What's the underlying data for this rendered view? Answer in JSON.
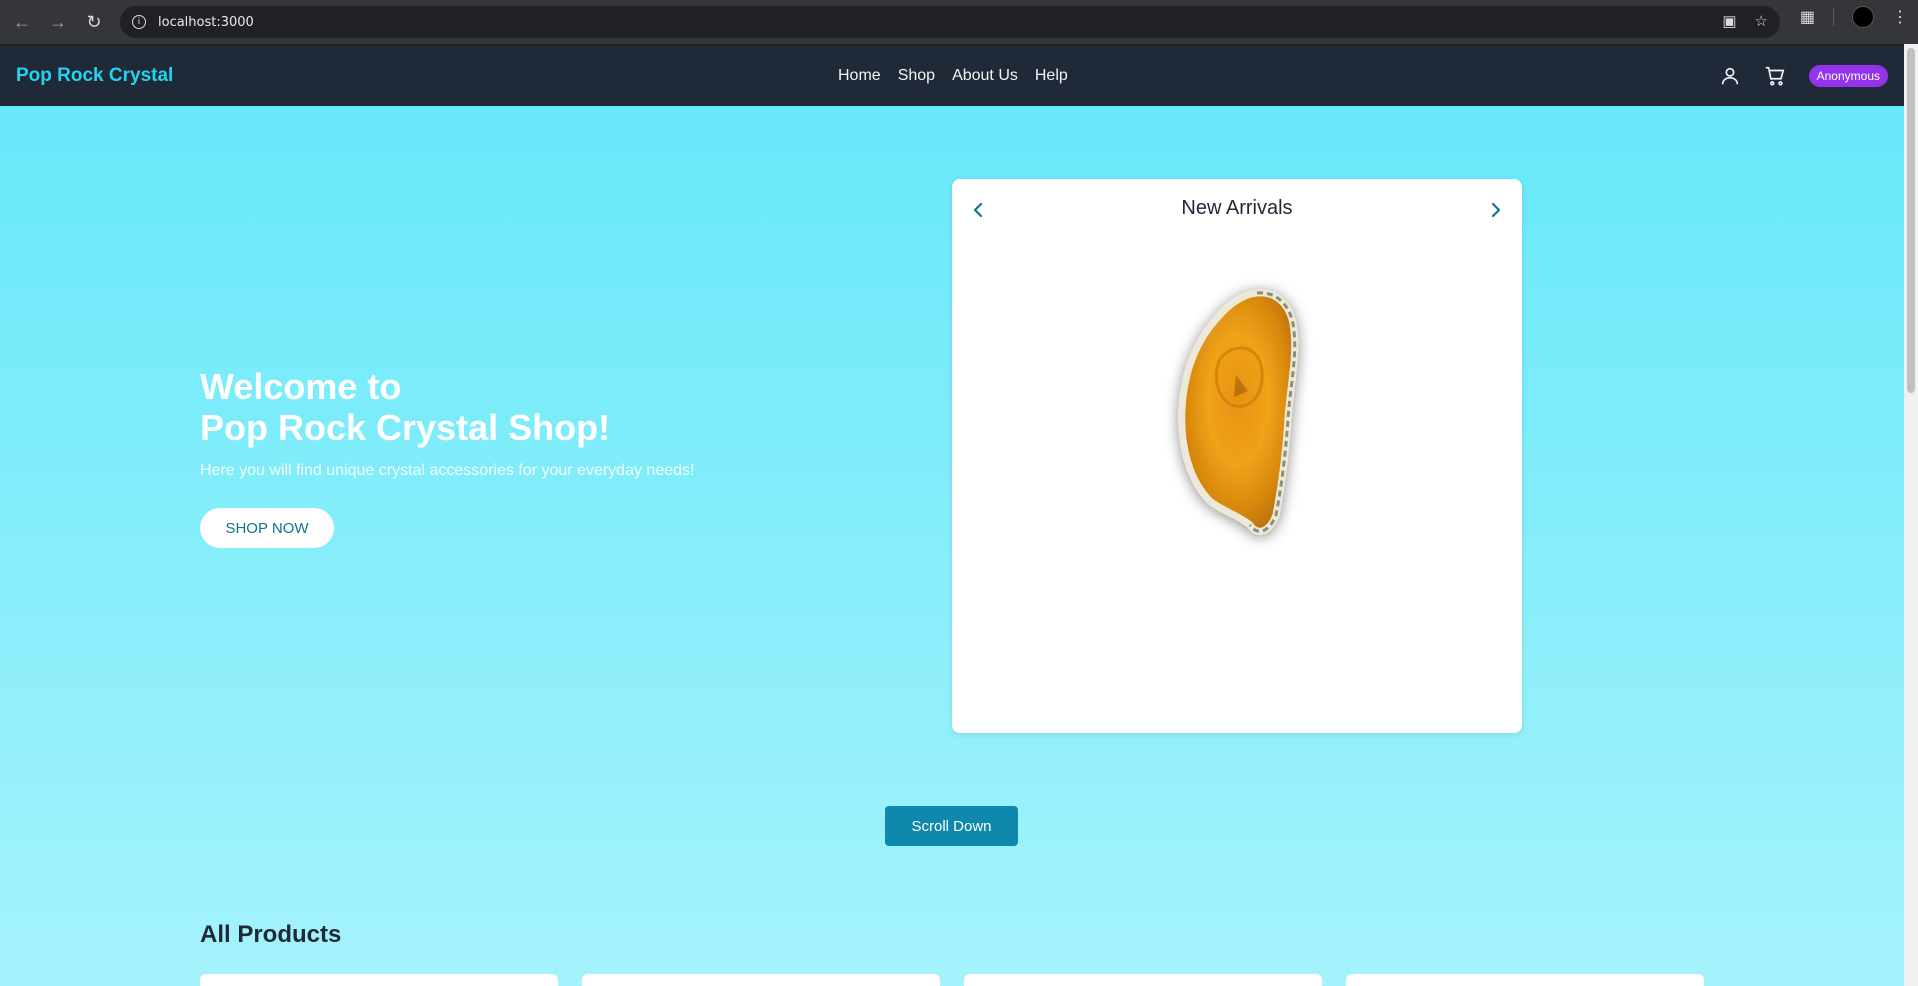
{
  "browser": {
    "url": "localhost:3000"
  },
  "header": {
    "brand": "Pop Rock Crystal",
    "nav": [
      "Home",
      "Shop",
      "About Us",
      "Help"
    ],
    "user_badge": "Anonymous",
    "icons": [
      "user-icon",
      "cart-icon"
    ]
  },
  "hero": {
    "title_line1": "Welcome to",
    "title_line2": "Pop Rock Crystal Shop!",
    "subtitle": "Here you will find unique crystal accessories for your everyday needs!",
    "cta": "SHOP NOW"
  },
  "carousel": {
    "title": "New Arrivals",
    "prev_icon": "chevron-left-icon",
    "next_icon": "chevron-right-icon",
    "image": "orange-agate-slice"
  },
  "scroll_button": "Scroll Down",
  "products": {
    "section_title": "All Products",
    "card_count": 4
  },
  "colors": {
    "accent": "#22d3ee",
    "header_bg": "#1f2937",
    "badge": "#9333ea",
    "button": "#0e89ad",
    "hero_gradient_top": "#67e8f9",
    "hero_gradient_bottom": "#a5f3fc"
  }
}
